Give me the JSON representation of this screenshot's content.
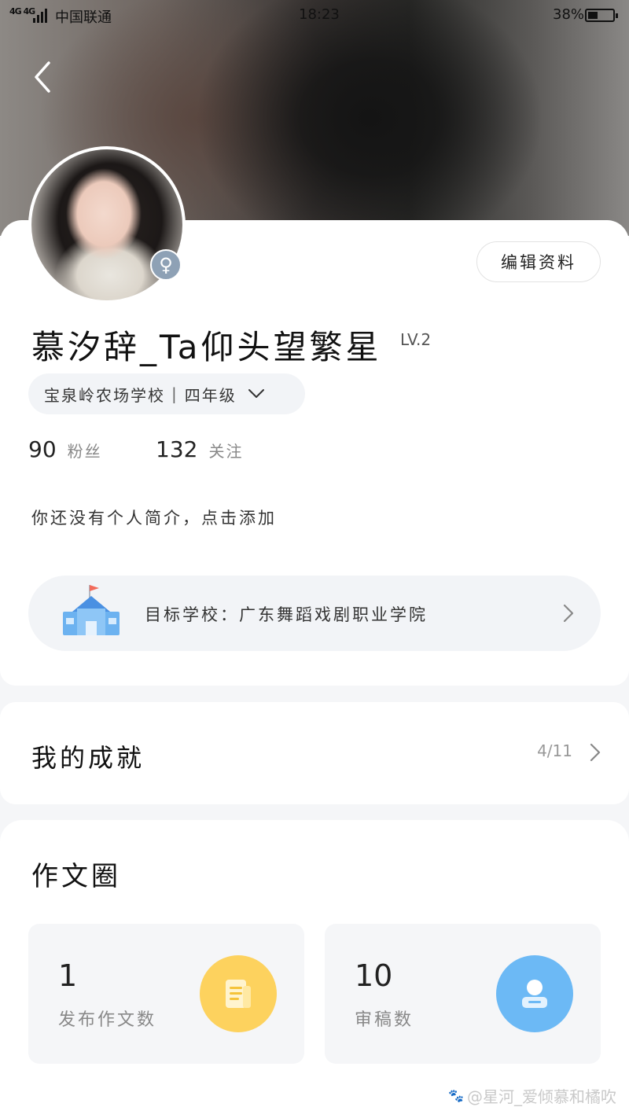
{
  "status_bar": {
    "signal": "4G 4G",
    "carrier": "中国联通",
    "time": "18:23",
    "battery": "38%"
  },
  "profile": {
    "edit_label": "编辑资料",
    "gender_symbol": "♀",
    "nickname": "慕汐辞_Ta仰头望繁星",
    "level": "LV.2",
    "school": "宝泉岭农场学校",
    "separator": "|",
    "grade": "四年级",
    "followers_count": "90",
    "followers_label": "粉丝",
    "following_count": "132",
    "following_label": "关注",
    "bio_placeholder": "你还没有个人简介，点击添加",
    "target_school_label": "目标学校：广东舞蹈戏剧职业学院"
  },
  "achievements": {
    "title": "我的成就",
    "progress": "4/11"
  },
  "essay_circle": {
    "title": "作文圈",
    "tiles": [
      {
        "value": "1",
        "label": "发布作文数",
        "icon": "document-icon",
        "color": "#fdd25e"
      },
      {
        "value": "10",
        "label": "审稿数",
        "icon": "reviewer-icon",
        "color": "#6cb9f5"
      }
    ]
  },
  "watermark": "@星河_爱倾慕和橘吹"
}
